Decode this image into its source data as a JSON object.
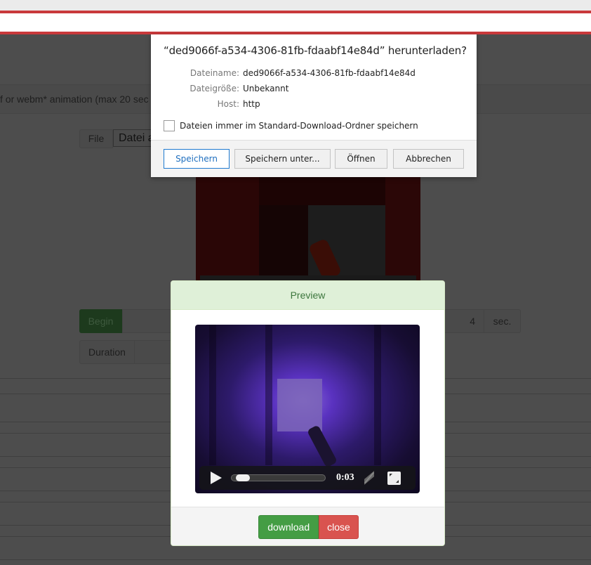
{
  "page": {
    "instruction_fragment": "f or webm* animation (max 20 sec",
    "file": {
      "addon_label": "File",
      "input_text": "Datei a"
    },
    "begin": {
      "label": "Begin",
      "value": "4",
      "unit": "sec."
    },
    "duration": {
      "label": "Duration"
    }
  },
  "preview_modal": {
    "title": "Preview",
    "player": {
      "time": "0:03",
      "progress_fraction": 0.05,
      "play_icon": "play-icon",
      "mute_icon": "mute-icon",
      "fullscreen_icon": "fullscreen-icon"
    },
    "buttons": {
      "download": "download",
      "close": "close"
    }
  },
  "download_dialog": {
    "title": "“ded9066f-a534-4306-81fb-fdaabf14e84d” herunterladen?",
    "fields": [
      {
        "label": "Dateiname:",
        "value": "ded9066f-a534-4306-81fb-fdaabf14e84d"
      },
      {
        "label": "Dateigröße:",
        "value": "Unbekannt"
      },
      {
        "label": "Host:",
        "value": "http"
      }
    ],
    "checkbox_label": "Dateien immer im Standard-Download-Ordner speichern",
    "checkbox_checked": false,
    "buttons": {
      "save": "Speichern",
      "save_as": "Speichern unter...",
      "open": "Öffnen",
      "cancel": "Abbrechen"
    }
  },
  "colors": {
    "accent_red": "#c9393b",
    "success_green": "#449d44",
    "danger_red": "#d9534f",
    "modal_header_bg": "#dff0d8",
    "modal_header_text": "#3c763d",
    "dialog_primary_blue": "#1f7ad0"
  }
}
